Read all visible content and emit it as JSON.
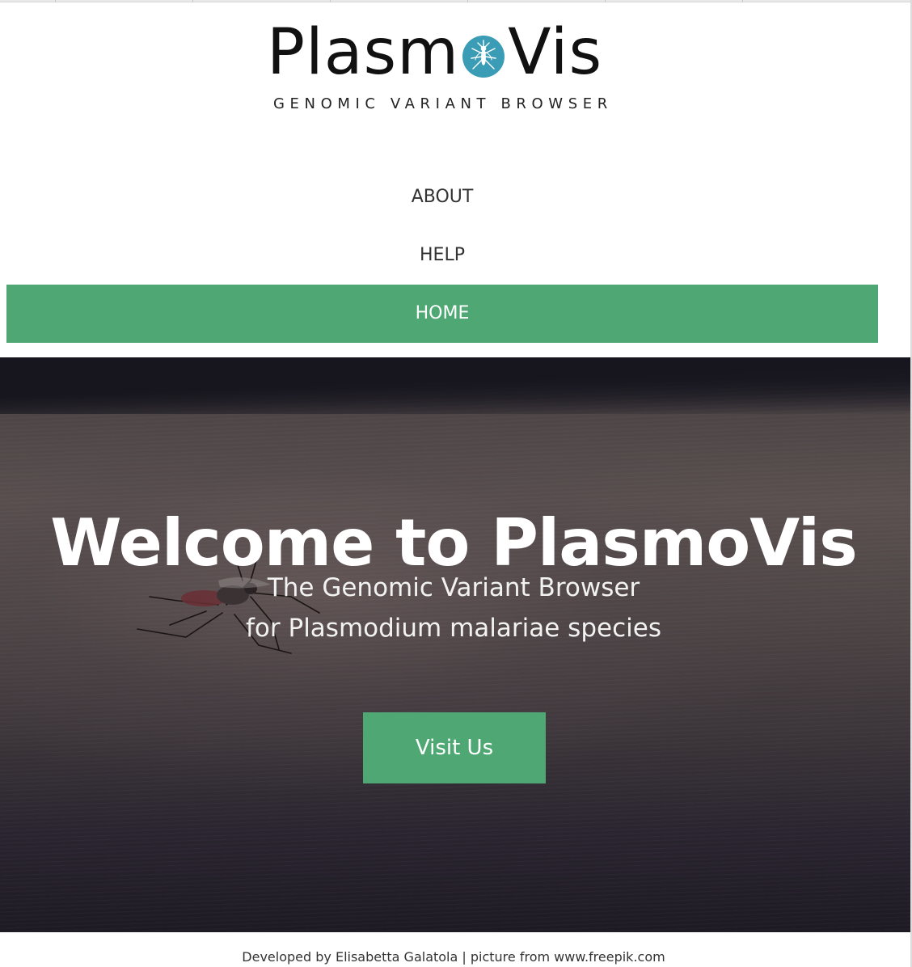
{
  "logo": {
    "word_left": "Plasm",
    "word_right": "Vis",
    "tagline": "GENOMIC VARIANT BROWSER",
    "badge_color": "#3b9db5",
    "badge_icon": "mosquito-icon"
  },
  "nav": {
    "items": [
      {
        "label": "ABOUT",
        "active": false
      },
      {
        "label": "HELP",
        "active": false
      },
      {
        "label": "HOME",
        "active": true
      }
    ],
    "active_color": "#4fa873"
  },
  "hero": {
    "title": "Welcome to PlasmoVis",
    "subtitle_line1": "The Genomic Variant Browser",
    "subtitle_line2": "for Plasmodium malariae species",
    "button_label": "Visit Us",
    "background_icon": "mosquito-on-skin-photo"
  },
  "footer": {
    "text": "Developed by Elisabetta Galatola | picture from www.freepik.com"
  },
  "colors": {
    "accent": "#4fa873",
    "text_dark": "#333333"
  }
}
